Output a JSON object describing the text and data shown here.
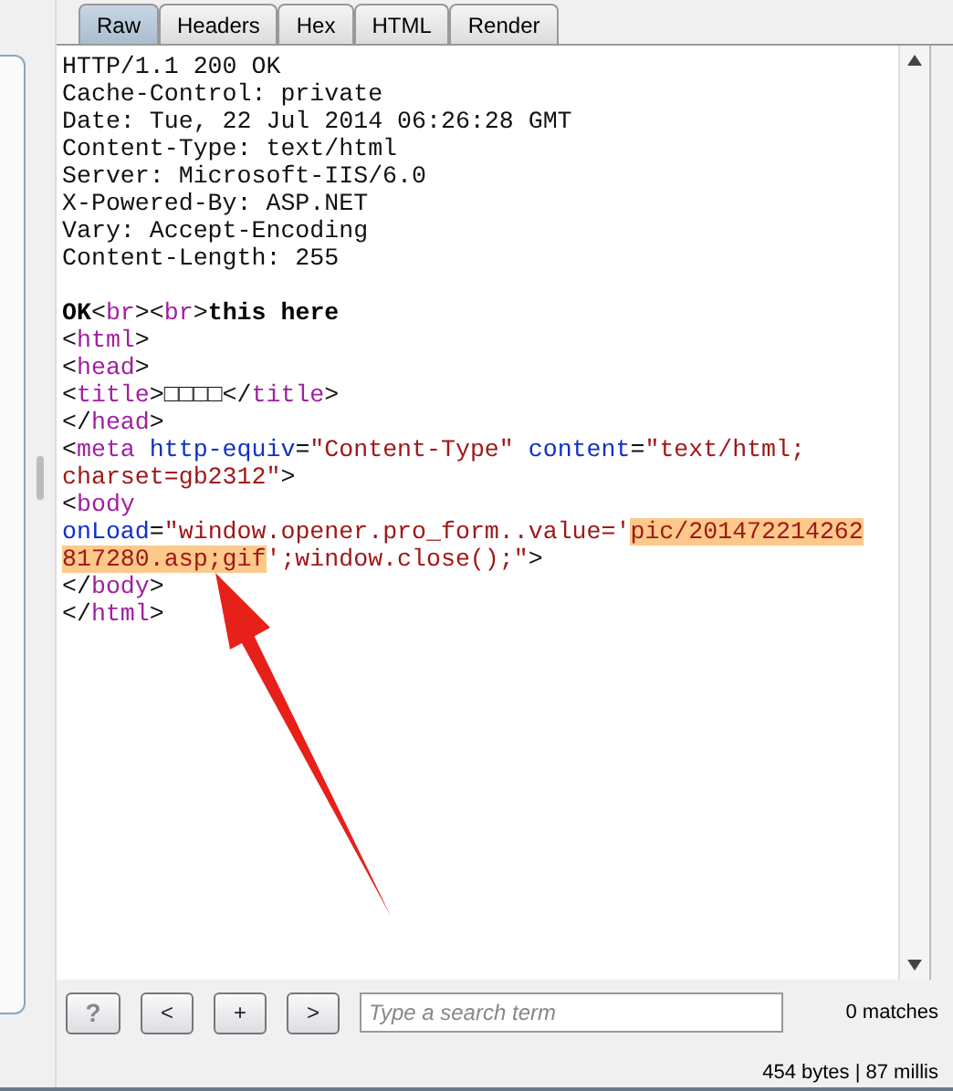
{
  "tabs": [
    {
      "label": "Raw",
      "selected": true
    },
    {
      "label": "Headers",
      "selected": false
    },
    {
      "label": "Hex",
      "selected": false
    },
    {
      "label": "HTML",
      "selected": false
    },
    {
      "label": "Render",
      "selected": false
    }
  ],
  "lines": [
    [
      {
        "kind": "text",
        "text": "HTTP/1.1 200 OK"
      }
    ],
    [
      {
        "kind": "text",
        "text": "Cache-Control: private"
      }
    ],
    [
      {
        "kind": "text",
        "text": "Date: Tue, 22 Jul 2014 06:26:28 GMT"
      }
    ],
    [
      {
        "kind": "text",
        "text": "Content-Type: text/html"
      }
    ],
    [
      {
        "kind": "text",
        "text": "Server: Microsoft-IIS/6.0"
      }
    ],
    [
      {
        "kind": "text",
        "text": "X-Powered-By: ASP.NET"
      }
    ],
    [
      {
        "kind": "text",
        "text": "Vary: Accept-Encoding"
      }
    ],
    [
      {
        "kind": "text",
        "text": "Content-Length: 255"
      }
    ]
  ],
  "body_lines": [
    [
      {
        "kind": "bold",
        "text": "OK"
      },
      {
        "kind": "text",
        "text": "<"
      },
      {
        "kind": "tag",
        "text": "br"
      },
      {
        "kind": "text",
        "text": "><"
      },
      {
        "kind": "tag",
        "text": "br"
      },
      {
        "kind": "text",
        "text": ">"
      },
      {
        "kind": "bold",
        "text": "this here"
      }
    ],
    [
      {
        "kind": "text",
        "text": "<"
      },
      {
        "kind": "tag",
        "text": "html"
      },
      {
        "kind": "text",
        "text": ">"
      }
    ],
    [
      {
        "kind": "text",
        "text": "<"
      },
      {
        "kind": "tag",
        "text": "head"
      },
      {
        "kind": "text",
        "text": ">"
      }
    ],
    [
      {
        "kind": "text",
        "text": "<"
      },
      {
        "kind": "tag",
        "text": "title"
      },
      {
        "kind": "text",
        "text": ">□□□□</"
      },
      {
        "kind": "tag",
        "text": "title"
      },
      {
        "kind": "text",
        "text": ">"
      }
    ],
    [
      {
        "kind": "text",
        "text": "</"
      },
      {
        "kind": "tag",
        "text": "head"
      },
      {
        "kind": "text",
        "text": ">"
      }
    ],
    [
      {
        "kind": "text",
        "text": "<"
      },
      {
        "kind": "tag",
        "text": "meta"
      },
      {
        "kind": "attr",
        "text": " http-equiv"
      },
      {
        "kind": "text",
        "text": "="
      },
      {
        "kind": "value",
        "text": "\"Content-Type\""
      },
      {
        "kind": "attr",
        "text": " content"
      },
      {
        "kind": "text",
        "text": "="
      },
      {
        "kind": "value",
        "text": "\"text/html;"
      }
    ],
    [
      {
        "kind": "value",
        "text": "charset=gb2312\""
      },
      {
        "kind": "text",
        "text": ">"
      }
    ],
    [
      {
        "kind": "text",
        "text": "<"
      },
      {
        "kind": "tag",
        "text": "body"
      }
    ],
    [
      {
        "kind": "attr",
        "text": "onLoad"
      },
      {
        "kind": "text",
        "text": "="
      },
      {
        "kind": "value",
        "text": "\"window.opener.pro_form..value='"
      },
      {
        "kind": "highlight",
        "text": "pic/201472214262"
      }
    ],
    [
      {
        "kind": "highlight",
        "text": "817280.asp;gif"
      },
      {
        "kind": "value",
        "text": "';window.close();\""
      },
      {
        "kind": "text",
        "text": ">"
      }
    ],
    [
      {
        "kind": "text",
        "text": "</"
      },
      {
        "kind": "tag",
        "text": "body"
      },
      {
        "kind": "text",
        "text": ">"
      }
    ],
    [
      {
        "kind": "text",
        "text": "</"
      },
      {
        "kind": "tag",
        "text": "html"
      },
      {
        "kind": "text",
        "text": ">"
      }
    ]
  ],
  "buttons": [
    "?",
    "<",
    "+",
    ">"
  ],
  "search": {
    "placeholder": "Type a search term"
  },
  "matches": "0 matches",
  "status": "454 bytes | 87 millis"
}
